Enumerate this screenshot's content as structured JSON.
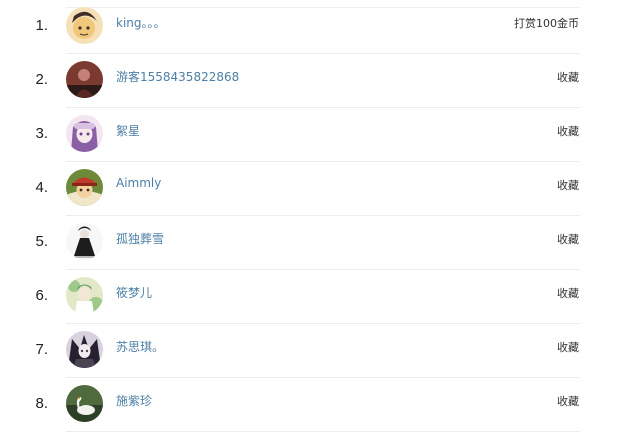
{
  "ranking": {
    "items": [
      {
        "rank": "1.",
        "name": "king。。。",
        "action": "打赏100金币",
        "avatar_icon": "avatar-cartoon-boy",
        "colors": [
          "#f1c77a",
          "#3f2e2a",
          "#f6e0b8"
        ]
      },
      {
        "rank": "2.",
        "name": "游客1558435822868",
        "action": "收藏",
        "avatar_icon": "avatar-person-photo",
        "colors": [
          "#7b3a2f",
          "#c6807a",
          "#2b1a17"
        ]
      },
      {
        "rank": "3.",
        "name": "絮星",
        "action": "收藏",
        "avatar_icon": "avatar-anime-girl-purple",
        "colors": [
          "#d8c2e4",
          "#8b5fa6",
          "#f3e6f0"
        ]
      },
      {
        "rank": "4.",
        "name": "Aimmly",
        "action": "收藏",
        "avatar_icon": "avatar-anime-red-hat",
        "colors": [
          "#c03a2b",
          "#6c8a3a",
          "#f2d2a0"
        ]
      },
      {
        "rank": "5.",
        "name": "孤独葬雪",
        "action": "收藏",
        "avatar_icon": "avatar-anime-dark-figure",
        "colors": [
          "#f7f7f7",
          "#1d1d1d",
          "#b9b9b9"
        ]
      },
      {
        "rank": "6.",
        "name": "筱梦儿",
        "action": "收藏",
        "avatar_icon": "avatar-anime-green",
        "colors": [
          "#9ec98a",
          "#e3e8c8",
          "#5f9a63"
        ]
      },
      {
        "rank": "7.",
        "name": "苏思琪。",
        "action": "收藏",
        "avatar_icon": "avatar-anime-gothic",
        "colors": [
          "#4a4452",
          "#d8d1de",
          "#262130"
        ]
      },
      {
        "rank": "8.",
        "name": "施紫珍",
        "action": "收藏",
        "avatar_icon": "avatar-swan-photo",
        "colors": [
          "#4f6a3c",
          "#f2f2ee",
          "#2d3f24"
        ]
      }
    ]
  }
}
